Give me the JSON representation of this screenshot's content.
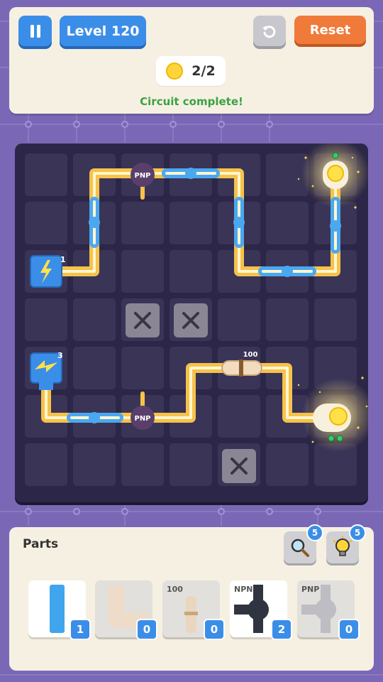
{
  "header": {
    "level_label": "Level 120",
    "reset_label": "Reset",
    "progress_text": "2/2",
    "status_text": "Circuit complete!"
  },
  "board": {
    "transistor_label_1": "PNP",
    "transistor_label_2": "PNP",
    "resistor_label": "100",
    "battery_1_badge": "1",
    "battery_2_badge": "3"
  },
  "parts": {
    "title": "Parts",
    "search_hint_count": "5",
    "bulb_hint_count": "5",
    "items": [
      {
        "label": "",
        "count": "1",
        "icon": "straight-wire-icon"
      },
      {
        "label": "",
        "count": "0",
        "icon": "corner-wire-icon"
      },
      {
        "label": "100",
        "count": "0",
        "icon": "resistor-icon"
      },
      {
        "label": "NPN",
        "count": "2",
        "icon": "npn-transistor-icon"
      },
      {
        "label": "PNP",
        "count": "0",
        "icon": "pnp-transistor-icon"
      }
    ]
  },
  "colors": {
    "background": "#7a68b6",
    "panel": "#f6f0e2",
    "board": "#2c2748",
    "wire_gold": "#f6c24a",
    "wire_blue": "#4aa8f0",
    "status_green": "#3aa243",
    "accent_blue": "#3b8ee8",
    "reset_orange": "#f07a3a"
  }
}
